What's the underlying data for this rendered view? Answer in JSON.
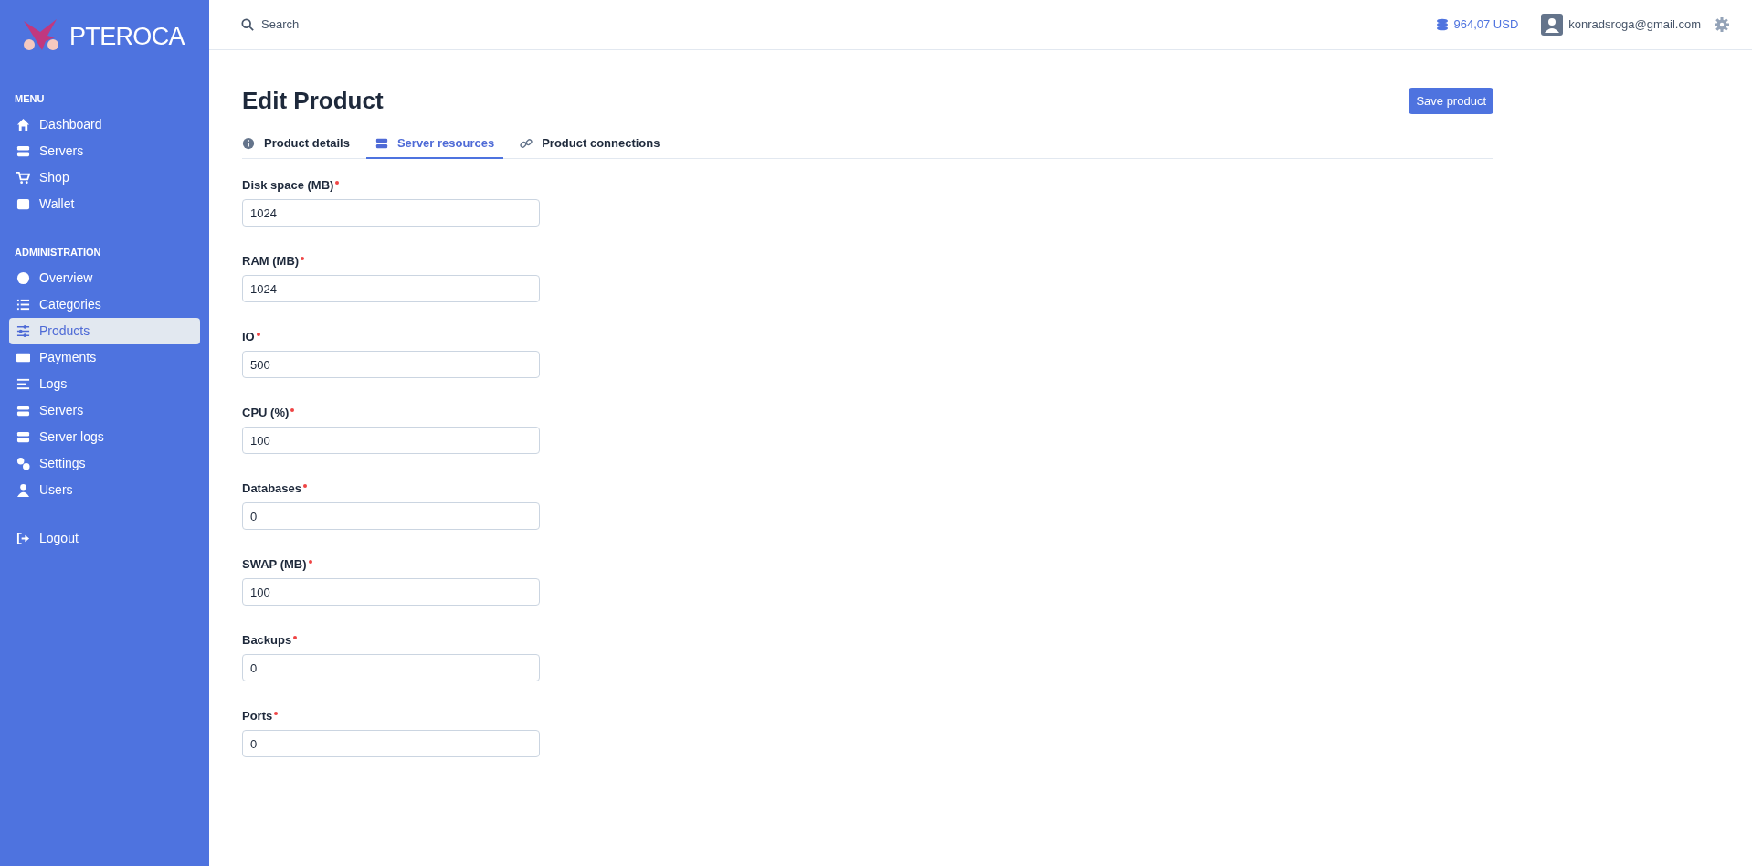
{
  "sidebar": {
    "logo": "PTEROCA",
    "sections": [
      {
        "heading": "MENU",
        "items": [
          {
            "label": "Dashboard",
            "selected": false
          },
          {
            "label": "Servers",
            "selected": false
          },
          {
            "label": "Shop",
            "selected": false
          },
          {
            "label": "Wallet",
            "selected": false
          }
        ]
      },
      {
        "heading": "ADMINISTRATION",
        "items": [
          {
            "label": "Overview",
            "selected": false
          },
          {
            "label": "Categories",
            "selected": false
          },
          {
            "label": "Products",
            "selected": true
          },
          {
            "label": "Payments",
            "selected": false
          },
          {
            "label": "Logs",
            "selected": false
          },
          {
            "label": "Servers",
            "selected": false
          },
          {
            "label": "Server logs",
            "selected": false
          },
          {
            "label": "Settings",
            "selected": false
          },
          {
            "label": "Users",
            "selected": false
          }
        ]
      }
    ],
    "logout": "Logout"
  },
  "header": {
    "search": {
      "placeholder": "Search"
    },
    "balance": "964,07 USD",
    "user": "konradsroga@gmail.com"
  },
  "page": {
    "title": "Edit Product",
    "save_button": "Save product",
    "tabs": [
      {
        "label": "Product details",
        "selected": false
      },
      {
        "label": "Server resources",
        "selected": true
      },
      {
        "label": "Product connections",
        "selected": false
      }
    ],
    "fields": [
      {
        "label": "Disk space (MB)",
        "required": true,
        "value": "1024"
      },
      {
        "label": "RAM (MB)",
        "required": true,
        "value": "1024"
      },
      {
        "label": "IO",
        "required": true,
        "value": "500"
      },
      {
        "label": "CPU (%)",
        "required": true,
        "value": "100"
      },
      {
        "label": "Databases",
        "required": true,
        "value": "0"
      },
      {
        "label": "SWAP (MB)",
        "required": true,
        "value": "100"
      },
      {
        "label": "Backups",
        "required": true,
        "value": "0"
      },
      {
        "label": "Ports",
        "required": true,
        "value": "0"
      }
    ]
  }
}
